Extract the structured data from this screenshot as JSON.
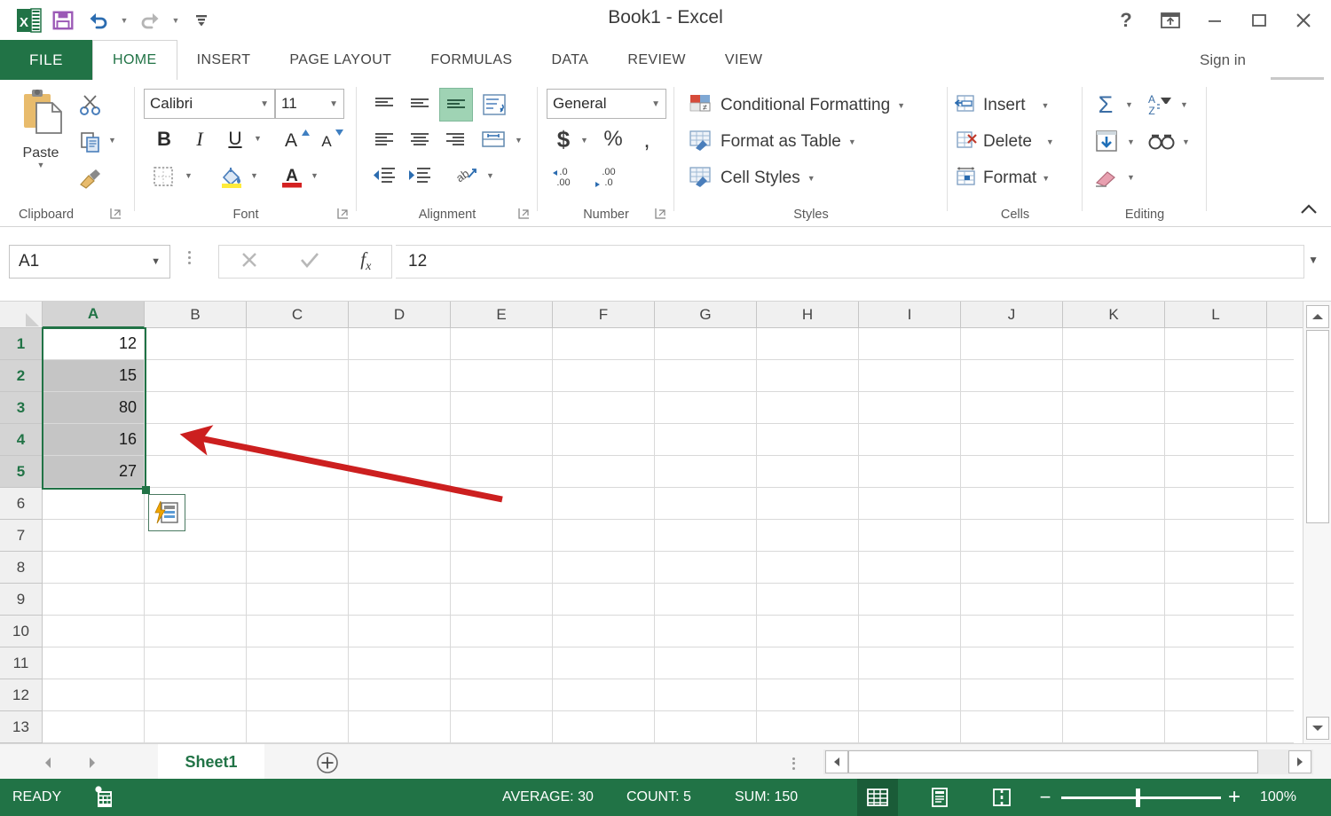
{
  "window": {
    "title": "Book1 - Excel",
    "help_icon": "help-icon",
    "ribbon_display_icon": "ribbon-display-options-icon",
    "minimize_icon": "minimize-icon",
    "maximize_icon": "maximize-icon",
    "close_icon": "close-icon",
    "signin_label": "Sign in"
  },
  "quick_access": [
    {
      "name": "excel-logo-icon",
      "label": "X"
    },
    {
      "name": "save-icon",
      "label": "Save"
    },
    {
      "name": "undo-icon",
      "label": "Undo"
    },
    {
      "name": "redo-icon",
      "label": "Redo"
    },
    {
      "name": "customize-qat-icon",
      "label": "Customize Quick Access Toolbar"
    }
  ],
  "ribbon": {
    "file_tab": "FILE",
    "tabs": [
      {
        "label": "HOME",
        "active": true
      },
      {
        "label": "INSERT",
        "active": false
      },
      {
        "label": "PAGE LAYOUT",
        "active": false
      },
      {
        "label": "FORMULAS",
        "active": false
      },
      {
        "label": "DATA",
        "active": false
      },
      {
        "label": "REVIEW",
        "active": false
      },
      {
        "label": "VIEW",
        "active": false
      }
    ],
    "collapse_icon": "collapse-ribbon-icon",
    "groups": {
      "clipboard": {
        "label": "Clipboard",
        "paste_label": "Paste",
        "cut_label": "Cut",
        "copy_label": "Copy",
        "format_painter_label": "Format Painter"
      },
      "font": {
        "label": "Font",
        "font_name": "Calibri",
        "font_size": "11",
        "bold": "B",
        "italic": "I",
        "underline": "U",
        "grow_font": "A",
        "shrink_font": "A",
        "borders_label": "Borders",
        "fill_color_label": "Fill Color",
        "font_color_label": "Font Color"
      },
      "alignment": {
        "label": "Alignment",
        "top_align": "Top Align",
        "middle_align": "Middle Align",
        "bottom_align": "Bottom Align",
        "wrap_text": "Wrap Text",
        "align_left": "Align Left",
        "center": "Center",
        "align_right": "Align Right",
        "merge_center": "Merge & Center",
        "decrease_indent": "Decrease Indent",
        "increase_indent": "Increase Indent",
        "orientation": "Orientation"
      },
      "number": {
        "label": "Number",
        "format": "General",
        "accounting": "$",
        "percent": "%",
        "comma": ",",
        "increase_decimal": ".00",
        "decrease_decimal": ".00"
      },
      "styles": {
        "label": "Styles",
        "items": [
          {
            "label": "Conditional Formatting",
            "icon": "conditional-formatting-icon"
          },
          {
            "label": "Format as Table",
            "icon": "format-as-table-icon"
          },
          {
            "label": "Cell Styles",
            "icon": "cell-styles-icon"
          }
        ]
      },
      "cells": {
        "label": "Cells",
        "items": [
          {
            "label": "Insert",
            "icon": "insert-cells-icon"
          },
          {
            "label": "Delete",
            "icon": "delete-cells-icon"
          },
          {
            "label": "Format",
            "icon": "format-cells-icon"
          }
        ]
      },
      "editing": {
        "label": "Editing",
        "autosum": "AutoSum",
        "fill": "Fill",
        "clear": "Clear",
        "sort_filter": "Sort & Filter",
        "find_select": "Find & Select"
      }
    }
  },
  "formula_bar": {
    "name_box_value": "A1",
    "name_box_dropdown": "name-box-dropdown-icon",
    "cancel_icon": "cancel-icon",
    "enter_icon": "enter-icon",
    "function_icon": "insert-function-icon",
    "formula_value": "12",
    "expand_icon": "expand-formula-bar-icon"
  },
  "grid": {
    "columns": [
      "A",
      "B",
      "C",
      "D",
      "E",
      "F",
      "G",
      "H",
      "I",
      "J",
      "K",
      "L"
    ],
    "selected_column": "A",
    "rows": [
      "1",
      "2",
      "3",
      "4",
      "5",
      "6",
      "7",
      "8",
      "9",
      "10",
      "11",
      "12",
      "13"
    ],
    "selected_rows": [
      "1",
      "2",
      "3",
      "4",
      "5"
    ],
    "cells": [
      {
        "ref": "A1",
        "row": 1,
        "col": "A",
        "value": "12",
        "selected": false,
        "active": true
      },
      {
        "ref": "A2",
        "row": 2,
        "col": "A",
        "value": "15",
        "selected": true,
        "active": false
      },
      {
        "ref": "A3",
        "row": 3,
        "col": "A",
        "value": "80",
        "selected": true,
        "active": false
      },
      {
        "ref": "A4",
        "row": 4,
        "col": "A",
        "value": "16",
        "selected": true,
        "active": false
      },
      {
        "ref": "A5",
        "row": 5,
        "col": "A",
        "value": "27",
        "selected": true,
        "active": false
      }
    ],
    "selection_range": "A1:A5",
    "autofill_options_icon": "autofill-options-icon",
    "annotation_arrow": "red-arrow-annotation"
  },
  "sheet_tabs": {
    "prev_icon": "previous-sheet-icon",
    "next_icon": "next-sheet-icon",
    "tabs": [
      {
        "label": "Sheet1",
        "active": true
      }
    ],
    "add_sheet_icon": "new-sheet-icon",
    "tab_menu_icon": "sheet-tab-menu-icon"
  },
  "scrollbars": {
    "v_up_icon": "scroll-up-icon",
    "v_down_icon": "scroll-down-icon",
    "h_left_icon": "scroll-left-icon",
    "h_right_icon": "scroll-right-icon"
  },
  "status_bar": {
    "mode": "READY",
    "macro_icon": "record-macro-icon",
    "average": "AVERAGE: 30",
    "count": "COUNT: 5",
    "sum": "SUM: 150",
    "view_normal_icon": "normal-view-icon",
    "view_pagelayout_icon": "page-layout-view-icon",
    "view_pagebreak_icon": "page-break-preview-icon",
    "zoom_out": "−",
    "zoom_in": "+",
    "zoom_level": "100%"
  },
  "colors": {
    "excel_green": "#217346",
    "status_green": "#217346",
    "annotation_red": "#cc1f1f",
    "selection_gray": "#c5c5c5",
    "header_gray": "#f0f0f0"
  }
}
